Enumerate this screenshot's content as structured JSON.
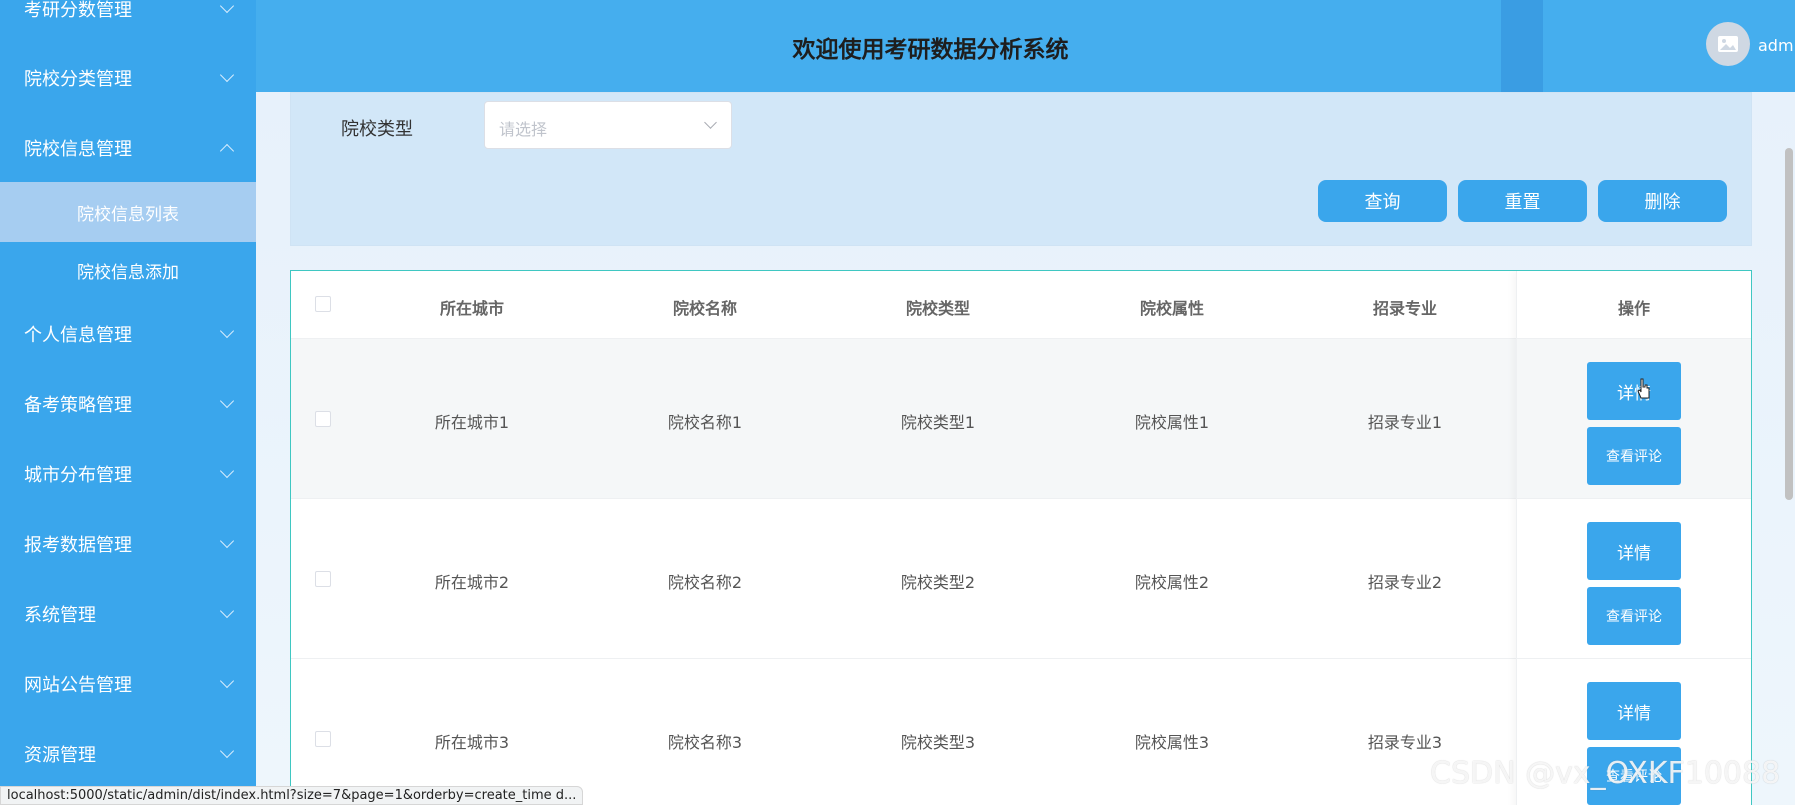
{
  "sidebar": {
    "items": [
      {
        "label": "考研分数管理",
        "expanded": false
      },
      {
        "label": "院校分类管理",
        "expanded": false
      },
      {
        "label": "院校信息管理",
        "expanded": true
      },
      {
        "label": "个人信息管理",
        "expanded": false
      },
      {
        "label": "备考策略管理",
        "expanded": false
      },
      {
        "label": "城市分布管理",
        "expanded": false
      },
      {
        "label": "报考数据管理",
        "expanded": false
      },
      {
        "label": "系统管理",
        "expanded": false
      },
      {
        "label": "网站公告管理",
        "expanded": false
      },
      {
        "label": "资源管理",
        "expanded": false
      }
    ],
    "submenu": [
      {
        "label": "院校信息列表",
        "active": true
      },
      {
        "label": "院校信息添加",
        "active": false
      }
    ]
  },
  "header": {
    "title": "欢迎使用考研数据分析系统",
    "username": "admi"
  },
  "filter": {
    "label": "院校类型",
    "placeholder": "请选择",
    "buttons": {
      "query": "查询",
      "reset": "重置",
      "delete": "删除"
    }
  },
  "table": {
    "headers": [
      "所在城市",
      "院校名称",
      "院校类型",
      "院校属性",
      "招录专业",
      "操作"
    ],
    "rows": [
      {
        "city": "所在城市1",
        "name": "院校名称1",
        "type": "院校类型1",
        "attr": "院校属性1",
        "major": "招录专业1"
      },
      {
        "city": "所在城市2",
        "name": "院校名称2",
        "type": "院校类型2",
        "attr": "院校属性2",
        "major": "招录专业2"
      },
      {
        "city": "所在城市3",
        "name": "院校名称3",
        "type": "院校类型3",
        "attr": "院校属性3",
        "major": "招录专业3"
      }
    ],
    "actions": {
      "detail": "详情",
      "comments": "查看评论"
    }
  },
  "statusbar": {
    "url": "localhost:5000/static/admin/dist/index.html?size=7&page=1&orderby=create_time d..."
  },
  "watermark": "CSDN @vx_OXKF10088",
  "colors": {
    "primary": "#3aa6ec",
    "header": "#45aeee",
    "table_border": "#3fc7c2",
    "active_submenu": "#a6cdf1"
  }
}
